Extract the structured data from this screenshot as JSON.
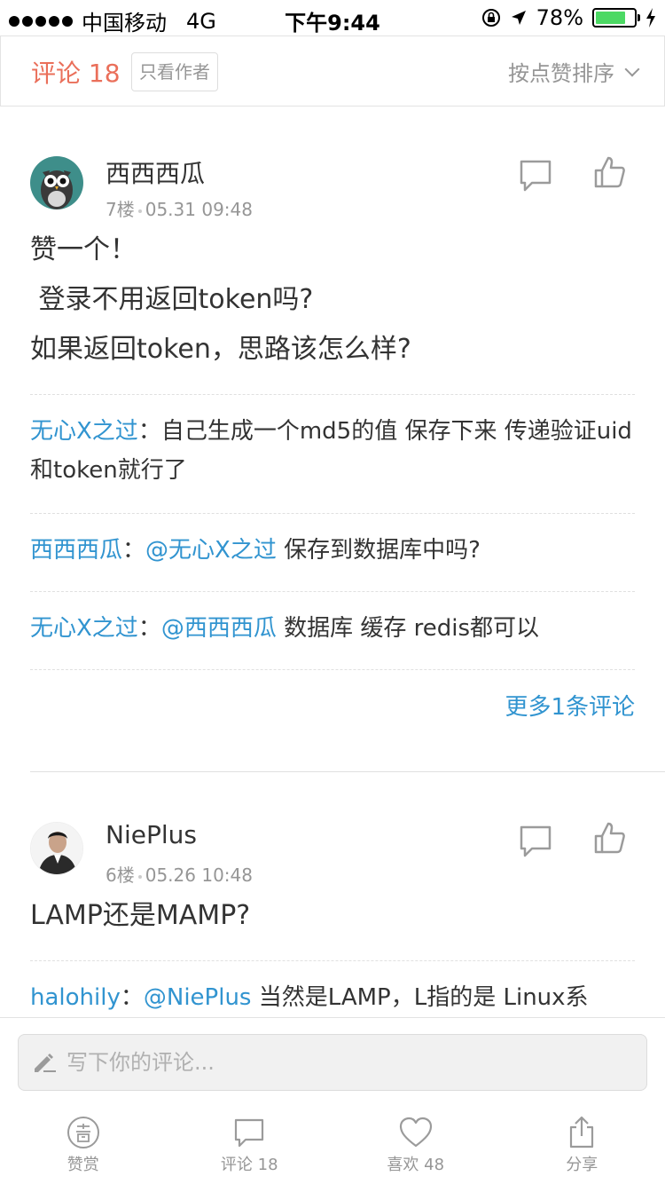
{
  "status_bar": {
    "carrier": "中国移动",
    "network": "4G",
    "time": "下午9:44",
    "battery": "78%",
    "battery_level": 0.78
  },
  "header": {
    "comment_count": "评论 18",
    "author_only": "只看作者",
    "sort": "按点赞排序"
  },
  "comments": [
    {
      "user": "西西西瓜",
      "floor": "7楼",
      "date": "05.31 09:48",
      "content": [
        "赞一个！",
        " 登录不用返回token吗?",
        "如果返回token，思路该怎么样?"
      ],
      "replies": [
        {
          "who": "无心X之过",
          "sep": "：",
          "mention": "",
          "text": "自己生成一个md5的值 保存下来 传递验证uid和token就行了"
        },
        {
          "who": "西西西瓜",
          "sep": "：",
          "mention": "@无心X之过",
          "text": " 保存到数据库中吗?"
        },
        {
          "who": "无心X之过",
          "sep": "：",
          "mention": "@西西西瓜",
          "text": " 数据库 缓存 redis都可以"
        }
      ],
      "more": "更多1条评论"
    },
    {
      "user": "NiePlus",
      "floor": "6楼",
      "date": "05.26 10:48",
      "content": [
        "LAMP还是MAMP?"
      ],
      "replies": [
        {
          "who": "halohily",
          "sep": "：",
          "mention": "@NiePlus",
          "text": " 当然是LAMP，L指的是 Linux系"
        }
      ]
    }
  ],
  "input": {
    "placeholder": "写下你的评论..."
  },
  "nav": [
    {
      "label": "赞赏",
      "icon": "reward-icon"
    },
    {
      "label": "评论 18",
      "icon": "comment-icon"
    },
    {
      "label": "喜欢 48",
      "icon": "heart-icon"
    },
    {
      "label": "分享",
      "icon": "share-icon"
    }
  ],
  "colors": {
    "accent": "#ea6f5a",
    "link": "#3194d0",
    "muted": "#969696"
  }
}
